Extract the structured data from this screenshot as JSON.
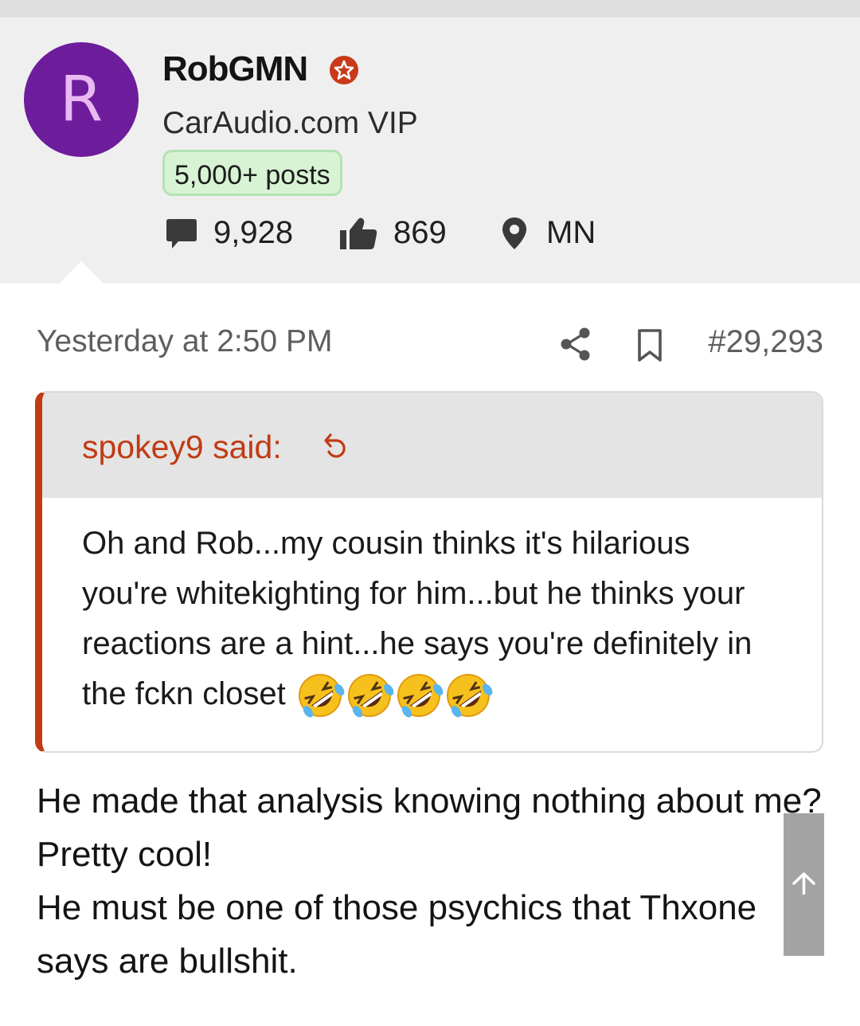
{
  "user": {
    "avatar_letter": "R",
    "name": "RobGMN",
    "title": "CarAudio.com VIP",
    "badge": "5,000+ posts",
    "stats": {
      "messages": "9,928",
      "reactions": "869",
      "location": "MN"
    }
  },
  "post": {
    "timestamp": "Yesterday at 2:50 PM",
    "number": "#29,293",
    "quote": {
      "author": "spokey9 said:",
      "text": "Oh and Rob...my cousin thinks it's hilarious you're whitekighting for him...but he thinks your reactions are a hint...he says you're definitely in the fckn closet",
      "emoji": "rolling-on-floor-laughing x4"
    },
    "reply_lines": [
      "He made that analysis knowing nothing about me? Pretty cool!",
      "He must be one of those psychics that Thxone says are bullshit."
    ]
  },
  "colors": {
    "avatar_bg": "#6d1d9c",
    "accent": "#c03b14",
    "badge_bg": "#d8f3d3",
    "header_bg": "#efefef"
  }
}
